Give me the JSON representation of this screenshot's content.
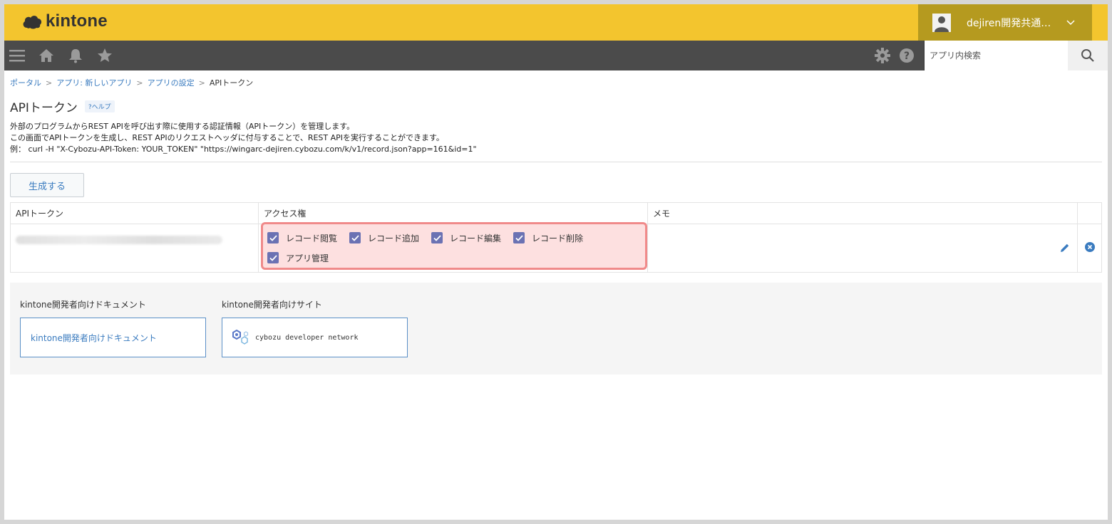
{
  "header": {
    "logo_text": "kintone",
    "user_name": "dejiren開発共通…",
    "colors": {
      "topbar": "#f3c52e",
      "navbar": "#4b4b4b",
      "user_box": "#b59a1f"
    }
  },
  "nav": {
    "left_icons": [
      "menu-icon",
      "home-icon",
      "bell-icon",
      "star-icon"
    ],
    "right_icons": [
      "gear-icon",
      "help-icon"
    ],
    "search": {
      "placeholder": "アプリ内検索",
      "value": ""
    }
  },
  "breadcrumb": {
    "items": [
      "ポータル",
      "アプリ: 新しいアプリ",
      "アプリの設定"
    ],
    "current": "APIトークン",
    "separator": ">"
  },
  "page": {
    "title": "APIトークン",
    "help_label": "?ヘルプ",
    "description": [
      "外部のプログラムからREST APIを呼び出す際に使用する認証情報（APIトークン）を管理します。",
      "この画面でAPIトークンを生成し、REST APIのリクエストヘッダに付与することで、REST APIを実行することができます。",
      "例： curl -H \"X-Cybozu-API-Token: YOUR_TOKEN\" \"https://wingarc-dejiren.cybozu.com/k/v1/record.json?app=161&id=1\""
    ],
    "generate_label": "生成する"
  },
  "table": {
    "headers": {
      "token": "APIトークン",
      "access": "アクセス権",
      "memo": "メモ"
    },
    "row": {
      "permissions": [
        "レコード閲覧",
        "レコード追加",
        "レコード編集",
        "レコード削除",
        "アプリ管理"
      ],
      "memo": ""
    }
  },
  "dev": {
    "docs_heading": "kintone開発者向けドキュメント",
    "docs_link": "kintone開発者向けドキュメント",
    "site_heading": "kintone開発者向けサイト",
    "site_link": "cybozu developer network"
  }
}
